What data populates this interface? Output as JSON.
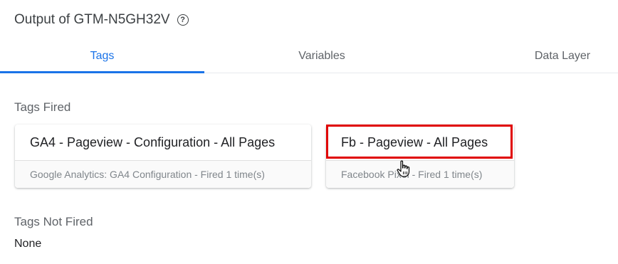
{
  "header": {
    "title": "Output of GTM-N5GH32V",
    "help_icon": "?"
  },
  "tabs": [
    {
      "label": "Tags",
      "active": true
    },
    {
      "label": "Variables",
      "active": false
    },
    {
      "label": "Data Layer",
      "active": false
    }
  ],
  "tags_fired": {
    "label": "Tags Fired",
    "cards": [
      {
        "title": "GA4 - Pageview - Configuration - All Pages",
        "subtitle": "Google Analytics: GA4 Configuration - Fired 1 time(s)"
      },
      {
        "title": "Fb - Pageview - All Pages",
        "subtitle": "Facebook Pixel - Fired 1 time(s)"
      }
    ]
  },
  "tags_not_fired": {
    "label": "Tags Not Fired",
    "value": "None"
  },
  "colors": {
    "accent": "#1a73e8",
    "highlight": "#e00000"
  },
  "icons": {
    "help": "help-circle-icon",
    "cursor": "hand-pointer-icon"
  }
}
